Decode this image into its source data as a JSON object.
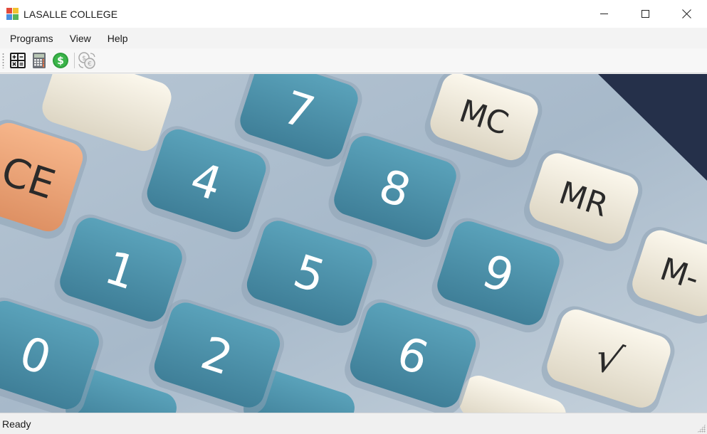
{
  "window": {
    "title": "LASALLE COLLEGE",
    "icon": "app-window-icon"
  },
  "menu": {
    "items": [
      {
        "label": "Programs"
      },
      {
        "label": "View"
      },
      {
        "label": "Help"
      }
    ]
  },
  "toolbar": {
    "buttons": [
      {
        "icon": "calculator-grid-icon"
      },
      {
        "icon": "calculator-icon"
      },
      {
        "icon": "dollar-coin-icon"
      },
      {
        "icon": "currency-exchange-icon",
        "enabled": false
      }
    ]
  },
  "main": {
    "image": "calculator-keypad-photo",
    "keys": [
      "7",
      "4",
      "1",
      "0",
      "8",
      "5",
      "2",
      "9",
      "6",
      "CE",
      "MC",
      "MR",
      "M-",
      "√"
    ]
  },
  "status": {
    "text": "Ready"
  },
  "colors": {
    "key_blue": "#4f94ad",
    "key_cream": "#f1ecdd",
    "key_orange": "#f0a878",
    "calc_body": "#a9bccd"
  }
}
